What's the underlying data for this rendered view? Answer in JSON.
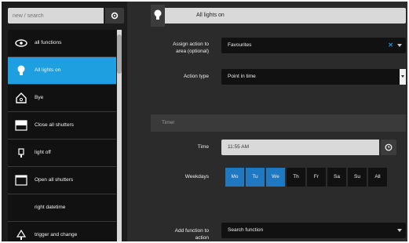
{
  "sidebar": {
    "search_placeholder": "new / search",
    "items": [
      {
        "label": "all functions",
        "icon": "eye-icon",
        "active": false
      },
      {
        "label": "All lights on",
        "icon": "lightbulb-icon",
        "active": true
      },
      {
        "label": "Bye",
        "icon": "house-icon",
        "active": false
      },
      {
        "label": "Close all shutters",
        "icon": "shutter-closed-icon",
        "active": false
      },
      {
        "label": "light off",
        "icon": "lamp-icon",
        "active": false
      },
      {
        "label": "Open all shutters",
        "icon": "shutter-open-icon",
        "active": false
      },
      {
        "label": "right datetime",
        "icon": "moon-icon",
        "active": false
      },
      {
        "label": "trigger and change",
        "icon": "tree-icon",
        "active": false
      }
    ]
  },
  "header": {
    "title": "All lights on",
    "icon": "lightbulb-icon"
  },
  "form": {
    "area_label_line1": "Assign action to",
    "area_label_line2": "area (optional)",
    "area_value": "Favourites",
    "area_clear": "✕",
    "action_type_label": "Action type",
    "action_type_value": "Point in time",
    "timer_section": "Timer",
    "time_label": "Time",
    "time_value": "11:55 AM",
    "weekdays_label": "Weekdays",
    "weekdays": [
      {
        "label": "Mo",
        "on": true
      },
      {
        "label": "Tu",
        "on": true
      },
      {
        "label": "We",
        "on": true
      },
      {
        "label": "Th",
        "on": false
      },
      {
        "label": "Fr",
        "on": false
      },
      {
        "label": "Sa",
        "on": false
      },
      {
        "label": "Su",
        "on": false
      },
      {
        "label": "All",
        "on": false
      }
    ],
    "add_function_line1": "Add function to",
    "add_function_line2": "action",
    "search_function": "Search function"
  },
  "colors": {
    "accent": "#1ea0e0",
    "day_on": "#1e78c2",
    "panel": "#2b2b2b",
    "list_bg": "#111111"
  }
}
